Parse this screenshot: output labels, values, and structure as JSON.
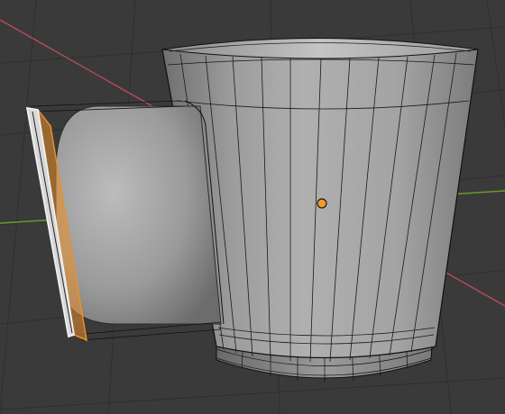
{
  "viewport": {
    "background": "#3a3a3a",
    "grid_color": "#2f2f2f",
    "x_axis_color": "#b34a55",
    "y_axis_color": "#6a9a2e"
  },
  "mesh": {
    "surface_color": "#9a9a9a",
    "wire_color": "#111111",
    "selected_edge_color": "#f0f0f0",
    "selected_face_color": "#e8902a",
    "origin_color": "#f29a2a"
  }
}
